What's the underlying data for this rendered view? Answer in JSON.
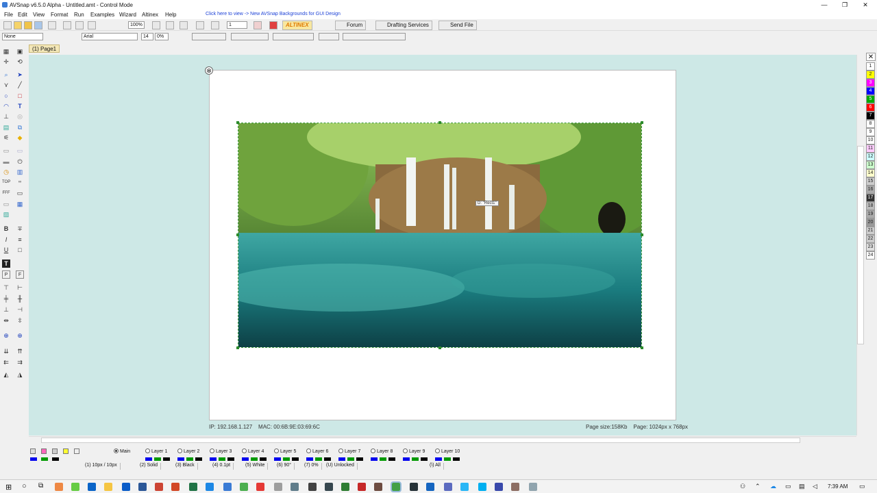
{
  "window": {
    "title": "AVSnap v6.5.0 Alpha - Untitled.amt - Control Mode",
    "minimize": "—",
    "maximize": "❐",
    "close": "✕"
  },
  "menu": {
    "items": [
      "File",
      "Edit",
      "View",
      "Format",
      "Run",
      "Examples",
      "Wizard",
      "Altinex",
      "Help"
    ],
    "link": "Click here to view -> New AVSnap Backgrounds for GUI Design"
  },
  "toolbar": {
    "zoom": "100%",
    "page_num": "1",
    "altinex": "ALTINEX",
    "forum": "Forum",
    "drafting": "Drafting Services",
    "send": "Send File"
  },
  "format_bar": {
    "style": "None",
    "font": "Arial",
    "size": "14",
    "pct": "0%"
  },
  "tabs": {
    "page": "(1) Page1"
  },
  "canvas": {
    "tooltip": "D: \"Rect1\"",
    "ip": "IP: 192.168.1.127    MAC: 00:6B:9E:03:69:6C",
    "page_info": "Page size:158Kb    Page: 1024px x 768px"
  },
  "palette": {
    "labels": [
      "1",
      "2",
      "3",
      "4",
      "5",
      "6",
      "7",
      "8",
      "9",
      "10",
      "11",
      "12",
      "13",
      "14",
      "15",
      "16",
      "17",
      "18",
      "19",
      "20",
      "21",
      "22",
      "23",
      "24"
    ],
    "colors": [
      "#ffffff",
      "#ffff00",
      "#ff00ff",
      "#0000ff",
      "#00aa00",
      "#ff0000",
      "#000000",
      "#ffffff",
      "#ffffff",
      "#ffffff",
      "#ffccff",
      "#ccffff",
      "#ccffcc",
      "#ffffcc",
      "#cccccc",
      "#aaaaaa",
      "#333333",
      "#bbbbbb",
      "#aaaaaa",
      "#999999",
      "#cccccc",
      "#cccccc",
      "#e0e0e0",
      "#ffffff"
    ]
  },
  "layers": {
    "main": "Main",
    "items": [
      "Layer 1",
      "Layer 2",
      "Layer 3",
      "Layer 4",
      "Layer 5",
      "Layer 6",
      "Layer 7",
      "Layer 8",
      "Layer 9",
      "Layer 10"
    ]
  },
  "props": [
    "(1) 10px / 10px",
    "(2) Solid",
    "(3) Black",
    "(4) 0.1pt",
    "(5) White",
    "(6) 90°",
    "(7) 0%",
    "(U) Unlocked",
    "(\\) All"
  ],
  "taskbar": {
    "time": "7:39 AM"
  }
}
